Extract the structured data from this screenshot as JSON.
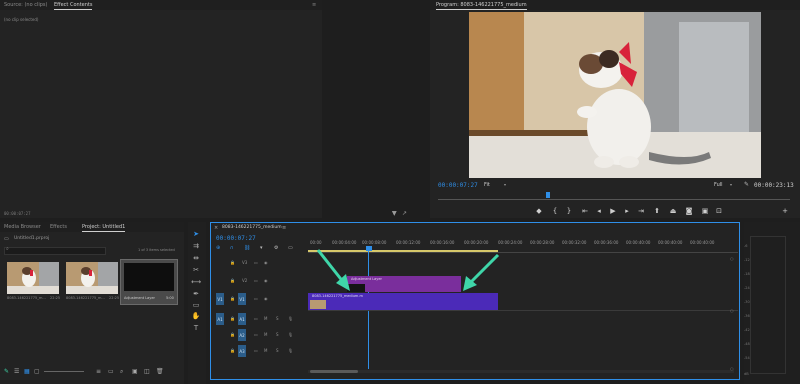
{
  "source_panel": {
    "tabs": [
      "Source: (no clips)",
      "Effect Contents"
    ],
    "active_tab": 1,
    "no_clip_text": "(no clip selected)",
    "timecode": "00:00:07:27"
  },
  "program_monitor": {
    "title": "Program: 8083-146221775_medium",
    "timecode": "00:00:07:27",
    "fit_label": "Fit",
    "quality_label": "Full",
    "duration": "00:00:23:13"
  },
  "project_panel": {
    "tabs": [
      "Media Browser",
      "Effects",
      "Project: Untitled1"
    ],
    "active_tab": 2,
    "project_file": "Untitled1.prproj",
    "selection_info": "1 of 3 items selected",
    "items": [
      {
        "name": "8083-146221775_m...",
        "duration": "22:25"
      },
      {
        "name": "8083-146221775_m...",
        "duration": "22:25"
      },
      {
        "name": "Adjustment Layer",
        "duration": "5:00"
      }
    ]
  },
  "timeline": {
    "sequence_name": "8083-146221775_medium",
    "timecode": "00:00:07:27",
    "ruler": [
      "00:00",
      "00:00:04:00",
      "00:00:08:00",
      "00:00:12:00",
      "00:00:16:00",
      "00:00:20:00",
      "00:00:24:00",
      "00:00:28:00",
      "00:00:32:00",
      "00:00:36:00",
      "00:00:40:00"
    ],
    "tracks": {
      "video": [
        "V3",
        "V2",
        "V1"
      ],
      "audio": [
        "A1",
        "A2",
        "A3"
      ],
      "source_video": "V1",
      "source_audio": "A1"
    },
    "clips": {
      "adjustment": "Adjustment Layer",
      "video": "8083-146221775_medium.m"
    }
  },
  "audio_meter": {
    "levels": [
      "-6",
      "-12",
      "-18",
      "-24",
      "-30",
      "-36",
      "-42",
      "-48",
      "-54",
      "dB"
    ]
  },
  "colors": {
    "accent": "#2f8fe8",
    "adjustment_clip": "#7a2e9c",
    "video_clip": "#4b2ab8",
    "arrow": "#3fd6a9",
    "panel_bg": "#232323"
  }
}
